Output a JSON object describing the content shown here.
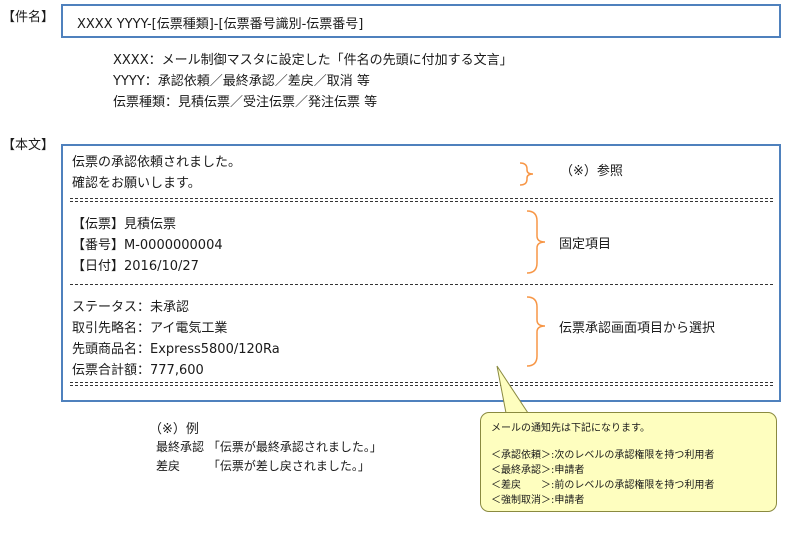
{
  "subject": {
    "label": "【件名】",
    "format": "XXXX YYYY-[伝票種類]-[伝票番号識別-伝票番号]"
  },
  "legend": [
    "XXXX：メール制御マスタに設定した「件名の先頭に付加する文言」",
    "YYYY：承認依頼／最終承認／差戻／取消 等",
    "伝票種類：見積伝票／受注伝票／発注伝票 等"
  ],
  "body": {
    "label": "【本文】",
    "greeting": [
      "伝票の承認依頼されました。",
      "確認をお願いします。"
    ],
    "fixed": [
      "【伝票】見積伝票",
      "【番号】M-0000000004",
      "【日付】2016/10/27"
    ],
    "selected": [
      "ステータス：未承認",
      "取引先略名：アイ電気工業",
      "先頭商品名：Express5800/120Ra",
      "伝票合計額：777,600"
    ]
  },
  "annotations": {
    "ref": "（※）参照",
    "fixed": "固定項目",
    "selected": "伝票承認画面項目から選択"
  },
  "note": {
    "title": "（※）例",
    "lines": [
      "最終承認 「伝票が最終承認されました。」",
      "差戻　　 「伝票が差し戻されました。」"
    ]
  },
  "callout": {
    "title": "メールの通知先は下記になります。",
    "lines": [
      "＜承認依頼＞:次のレベルの承認権限を持つ利用者",
      "＜最終承認＞:申請者",
      "＜差戻　　＞:前のレベルの承認権限を持つ利用者",
      "＜強制取消＞:申請者"
    ]
  },
  "colors": {
    "box_border": "#4f81bd",
    "brace": "#f79646",
    "callout_fill": "#fefebf"
  }
}
